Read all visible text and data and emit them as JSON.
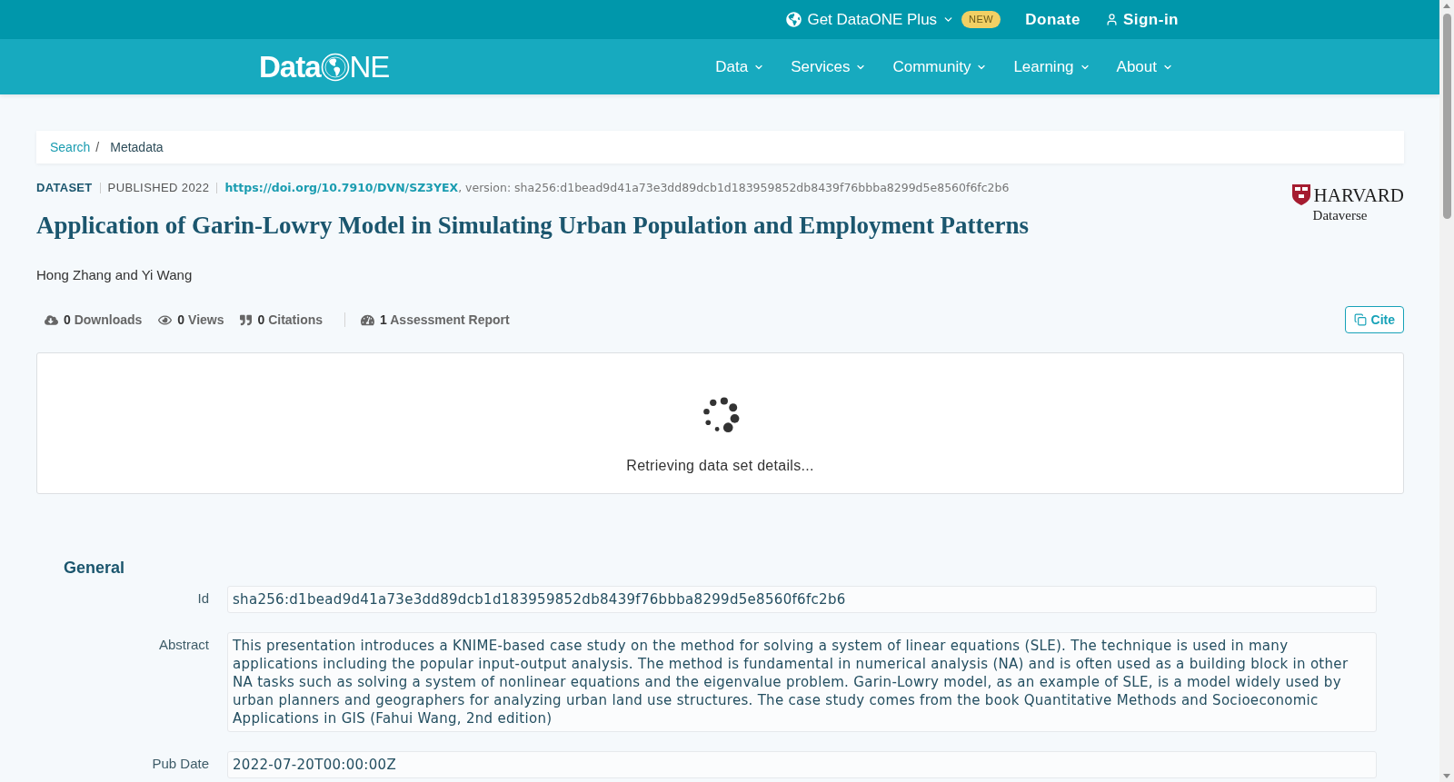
{
  "top_bar": [
    {
      "kind": "menu",
      "label": "Get DataONE Plus",
      "badge": "NEW"
    },
    {
      "kind": "link",
      "label": "Donate"
    },
    {
      "kind": "account",
      "label": "Sign-in"
    }
  ],
  "nav": {
    "logo": {
      "text_start": "Data",
      "text_end": "NE"
    },
    "items": [
      {
        "label": "Data"
      },
      {
        "label": "Services"
      },
      {
        "label": "Community"
      },
      {
        "label": "Learning"
      },
      {
        "label": "About"
      }
    ]
  },
  "breadcrumb": {
    "items": [
      {
        "kind": "link",
        "label": "Search"
      },
      {
        "kind": "current",
        "label": "Metadata"
      }
    ],
    "separator": "/"
  },
  "dataset": {
    "type": "DATASET",
    "published": "PUBLISHED 2022",
    "doi": "https://doi.org/10.7910/DVN/SZ3YEX",
    "version": ", version: sha256:d1bead9d41a73e3dd89dcb1d183959852db8439f76bbba8299d5e8560f6fc2b6",
    "title": "Application of Garin-Lowry Model in Simulating Urban Population and Employment Patterns",
    "authors": "Hong Zhang and Yi Wang",
    "repository_logo": {
      "name": "HARVARD",
      "subtitle": "Dataverse"
    }
  },
  "stats": [
    {
      "kind": "downloads",
      "count": "0",
      "label": "Downloads"
    },
    {
      "kind": "views",
      "count": "0",
      "label": "Views"
    },
    {
      "kind": "citations",
      "count": "0",
      "label": "Citations"
    },
    {
      "kind": "assessment",
      "count": "1",
      "label": "Assessment Report"
    }
  ],
  "cite_button": "Cite",
  "loading": {
    "message": "Retrieving data set details..."
  },
  "sections": [
    {
      "heading": "General",
      "fields": [
        {
          "label": "Id",
          "value": "sha256:d1bead9d41a73e3dd89dcb1d183959852db8439f76bbba8299d5e8560f6fc2b6"
        },
        {
          "label": "Abstract",
          "value": "This presentation introduces a KNIME-based case study on the method for solving a system of linear equations (SLE). The technique is used in many applications including the popular input-output analysis. The method is fundamental in numerical analysis (NA) and is often used as a building block in other NA tasks such as solving a system of nonlinear equations and the eigenvalue problem. Garin-Lowry model, as an example of SLE, is a model widely used by urban planners and geographers for analyzing urban land use structures. The case study comes from the book Quantitative Methods and Socioeconomic Applications in GIS (Fahui Wang, 2nd edition)"
        },
        {
          "label": "Pub Date",
          "value": "2022-07-20T00:00:00Z"
        }
      ]
    }
  ]
}
